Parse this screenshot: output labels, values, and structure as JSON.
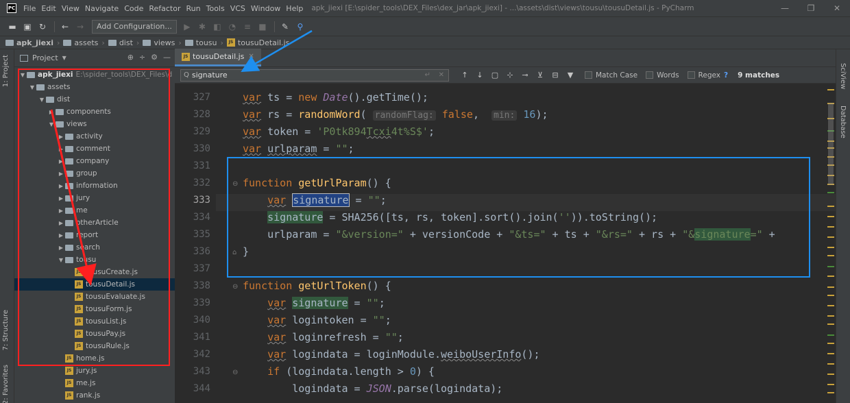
{
  "window": {
    "logo": "PC",
    "title": "apk_jiexi [E:\\spider_tools\\DEX_Files\\dex_jar\\apk_jiexi] - ...\\assets\\dist\\views\\tousu\\tousuDetail.js - PyCharm",
    "controls": [
      "—",
      "❐",
      "✕"
    ]
  },
  "menu": [
    "File",
    "Edit",
    "View",
    "Navigate",
    "Code",
    "Refactor",
    "Run",
    "Tools",
    "VCS",
    "Window",
    "Help"
  ],
  "toolbar": {
    "add_config": "Add Configuration..."
  },
  "breadcrumb": [
    "apk_jiexi",
    "assets",
    "dist",
    "views",
    "tousu",
    "tousuDetail.js"
  ],
  "sidebar_left": {
    "project": "1: Project",
    "structure": "7: Structure",
    "favorites": "2: Favorites"
  },
  "sidebar_right": {
    "sciview": "SciView",
    "database": "Database"
  },
  "project_panel": {
    "title": "Project",
    "tree": [
      {
        "label": "apk_jiexi",
        "path": "E:\\spider_tools\\DEX_Files\\d",
        "kind": "folder",
        "depth": 0,
        "open": true
      },
      {
        "label": "assets",
        "kind": "folder",
        "depth": 1,
        "open": true
      },
      {
        "label": "dist",
        "kind": "folder",
        "depth": 2,
        "open": true
      },
      {
        "label": "components",
        "kind": "folder",
        "depth": 3,
        "open": false
      },
      {
        "label": "views",
        "kind": "folder",
        "depth": 3,
        "open": true
      },
      {
        "label": "activity",
        "kind": "folder",
        "depth": 4,
        "open": false
      },
      {
        "label": "comment",
        "kind": "folder",
        "depth": 4,
        "open": false
      },
      {
        "label": "company",
        "kind": "folder",
        "depth": 4,
        "open": false
      },
      {
        "label": "group",
        "kind": "folder",
        "depth": 4,
        "open": false
      },
      {
        "label": "information",
        "kind": "folder",
        "depth": 4,
        "open": false
      },
      {
        "label": "jury",
        "kind": "folder",
        "depth": 4,
        "open": false
      },
      {
        "label": "me",
        "kind": "folder",
        "depth": 4,
        "open": false
      },
      {
        "label": "otherArticle",
        "kind": "folder",
        "depth": 4,
        "open": false
      },
      {
        "label": "report",
        "kind": "folder",
        "depth": 4,
        "open": false
      },
      {
        "label": "search",
        "kind": "folder",
        "depth": 4,
        "open": false
      },
      {
        "label": "tousu",
        "kind": "folder",
        "depth": 4,
        "open": true
      },
      {
        "label": "tousuCreate.js",
        "kind": "file",
        "depth": 5
      },
      {
        "label": "tousuDetail.js",
        "kind": "file",
        "depth": 5,
        "selected": true
      },
      {
        "label": "tousuEvaluate.js",
        "kind": "file",
        "depth": 5
      },
      {
        "label": "tousuForm.js",
        "kind": "file",
        "depth": 5
      },
      {
        "label": "tousuList.js",
        "kind": "file",
        "depth": 5
      },
      {
        "label": "tousuPay.js",
        "kind": "file",
        "depth": 5
      },
      {
        "label": "tousuRule.js",
        "kind": "file",
        "depth": 5
      },
      {
        "label": "home.js",
        "kind": "file",
        "depth": 4
      },
      {
        "label": "jury.js",
        "kind": "file",
        "depth": 4
      },
      {
        "label": "me.js",
        "kind": "file",
        "depth": 4
      },
      {
        "label": "rank.js",
        "kind": "file",
        "depth": 4
      }
    ]
  },
  "editor": {
    "tab": "tousuDetail.js",
    "search": {
      "query": "signature",
      "options": [
        "Match Case",
        "Words",
        "Regex"
      ],
      "help": "?",
      "matches": "9 matches"
    },
    "current_line": 333,
    "lines": [
      {
        "n": 327,
        "code": "var ts = new Date().getTime();"
      },
      {
        "n": 328,
        "code": "var rs = randomWord(randomFlag: false, min: 16);"
      },
      {
        "n": 329,
        "code": "var token = 'P0tk894Tcxi4t%S$';"
      },
      {
        "n": 330,
        "code": "var urlparam = \"\";"
      },
      {
        "n": 331,
        "code": ""
      },
      {
        "n": 332,
        "code": "function getUrlParam() {"
      },
      {
        "n": 333,
        "code": "    var signature = \"\";"
      },
      {
        "n": 334,
        "code": "    signature = SHA256([ts, rs, token].sort().join('')).toString();"
      },
      {
        "n": 335,
        "code": "    urlparam = \"&version=\" + versionCode + \"&ts=\" + ts + \"&rs=\" + rs + \"&signature=\" +"
      },
      {
        "n": 336,
        "code": "}"
      },
      {
        "n": 337,
        "code": ""
      },
      {
        "n": 338,
        "code": "function getUrlToken() {"
      },
      {
        "n": 339,
        "code": "    var signature = \"\";"
      },
      {
        "n": 340,
        "code": "    var logintoken = \"\";"
      },
      {
        "n": 341,
        "code": "    var loginrefresh = \"\";"
      },
      {
        "n": 342,
        "code": "    var logindata = loginModule.weiboUserInfo();"
      },
      {
        "n": 343,
        "code": "    if (logindata.length > 0) {"
      },
      {
        "n": 344,
        "code": "        logindata = JSON.parse(logindata);"
      }
    ]
  },
  "colors": {
    "annotation_red": "#ff2020",
    "annotation_blue": "#1e8ff0",
    "search_highlight": "#32593d",
    "selection": "#214283"
  }
}
